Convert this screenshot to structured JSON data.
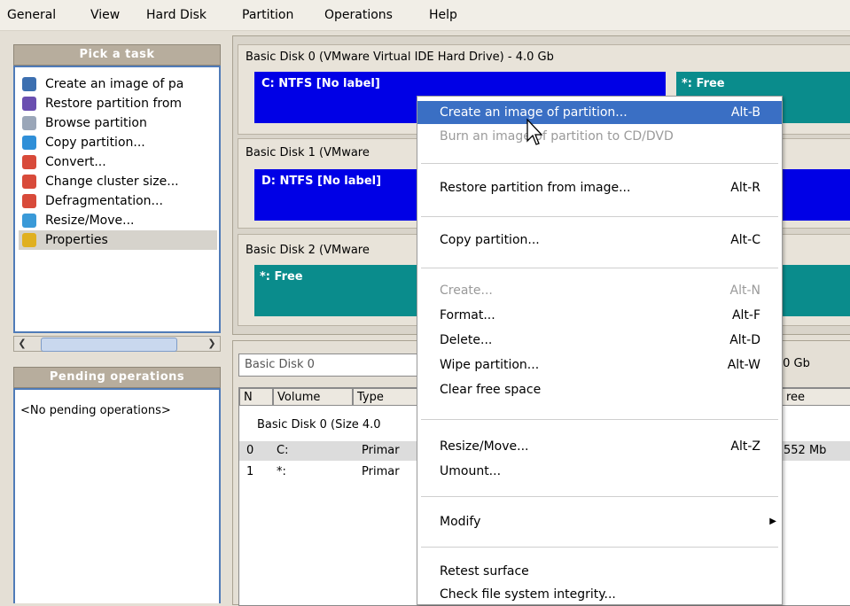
{
  "menu": [
    "General",
    "View",
    "Hard Disk",
    "Partition",
    "Operations",
    "Help"
  ],
  "task_panel": {
    "title": "Pick a task",
    "items": [
      {
        "label": "Create an image of pa",
        "icon": "image-icon"
      },
      {
        "label": "Restore partition from",
        "icon": "restore-icon"
      },
      {
        "label": "Browse partition",
        "icon": "browse-icon"
      },
      {
        "label": "Copy partition...",
        "icon": "copy-icon"
      },
      {
        "label": "Convert...",
        "icon": "convert-icon"
      },
      {
        "label": "Change cluster size...",
        "icon": "cluster-icon"
      },
      {
        "label": "Defragmentation...",
        "icon": "defrag-icon"
      },
      {
        "label": "Resize/Move...",
        "icon": "resize-icon"
      },
      {
        "label": "Properties",
        "icon": "properties-icon"
      }
    ]
  },
  "pending": {
    "title": "Pending operations",
    "empty": "<No pending operations>"
  },
  "disks": [
    {
      "title": "Basic Disk 0 (VMware Virtual IDE Hard Drive) - 4.0 Gb",
      "part1": "C: NTFS [No label]",
      "part2": "*: Free"
    },
    {
      "title": "Basic Disk 1 (VMware",
      "part1": "D: NTFS [No label]"
    },
    {
      "title": "Basic Disk 2 (VMware",
      "part1": "*: Free"
    }
  ],
  "detail": {
    "selector": "Basic Disk 0",
    "size_right": ".0 Gb",
    "columns": [
      "N",
      "Volume",
      "Type",
      "ree"
    ],
    "group": "Basic Disk 0 (Size 4.0",
    "rows": [
      {
        "n": "0",
        "vol": "C:",
        "type": "Primar",
        "free": "552 Mb"
      },
      {
        "n": "1",
        "vol": "*:",
        "type": "Primar",
        "free": ""
      }
    ]
  },
  "context_menu": [
    {
      "label": "Create an image of partition...",
      "accel": "Alt-B",
      "state": "selected"
    },
    {
      "label": "Burn an image of partition to CD/DVD",
      "accel": "",
      "state": "disabled"
    },
    {
      "label": "Restore partition from image...",
      "accel": "Alt-R",
      "state": "normal"
    },
    {
      "label": "Copy partition...",
      "accel": "Alt-C",
      "state": "normal"
    },
    {
      "label": "Create...",
      "accel": "Alt-N",
      "state": "disabled"
    },
    {
      "label": "Format...",
      "accel": "Alt-F",
      "state": "normal"
    },
    {
      "label": "Delete...",
      "accel": "Alt-D",
      "state": "normal"
    },
    {
      "label": "Wipe partition...",
      "accel": "Alt-W",
      "state": "normal"
    },
    {
      "label": "Clear free space",
      "accel": "",
      "state": "normal"
    },
    {
      "label": "Resize/Move...",
      "accel": "Alt-Z",
      "state": "normal"
    },
    {
      "label": "Umount...",
      "accel": "",
      "state": "normal"
    },
    {
      "label": "Modify",
      "accel": "",
      "state": "normal"
    },
    {
      "label": "Retest surface",
      "accel": "",
      "state": "normal"
    },
    {
      "label": "Check file system integrity...",
      "accel": "",
      "state": "normal"
    }
  ],
  "colors": {
    "selected": "#3a6fc4",
    "partition_blue": "#0000e6",
    "partition_teal": "#0a8c8c"
  }
}
